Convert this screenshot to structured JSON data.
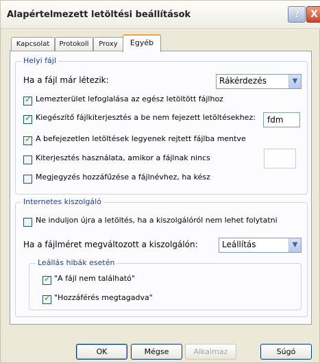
{
  "window": {
    "title": "Alapértelmezett letöltési beállítások",
    "help_label": "?",
    "close_label": "X"
  },
  "tabs": [
    {
      "label": "Kapcsolat"
    },
    {
      "label": "Protokoll"
    },
    {
      "label": "Proxy"
    },
    {
      "label": "Egyéb",
      "active": true
    }
  ],
  "local_file": {
    "legend": "Helyi fájl",
    "if_exists_label": "Ha a fájl már létezik:",
    "if_exists_value": "Rákérdezés",
    "options": [
      {
        "label": "Lemezterület lefoglalása az egész letöltött fájlhoz",
        "checked": true
      },
      {
        "label": "Kiegészítő fájlkiterjesztés a be nem fejezett letöltésekhez:",
        "checked": true,
        "value": "fdm"
      },
      {
        "label": "A befejezetlen letöltések legyenek rejtett fájlba mentve",
        "checked": true
      },
      {
        "label": "Kiterjesztés használata, amikor a fájlnak nincs",
        "checked": false,
        "value": ""
      },
      {
        "label": "Megjegyzés hozzáfűzése a fájlnévhez, ha kész",
        "checked": false
      }
    ]
  },
  "internet_server": {
    "legend": "Internetes kiszolgáló",
    "no_restart_label": "Ne induljon újra a letöltés, ha a kiszolgálóról nem lehet folytatni",
    "no_restart_checked": false,
    "size_changed_label": "Ha a fájlméret megváltozott a kiszolgálón:",
    "size_changed_value": "Leállítás",
    "stop_errors": {
      "legend": "Leállás hibák esetén",
      "items": [
        {
          "label": "\"A fájl nem található\"",
          "checked": true
        },
        {
          "label": "\"Hozzáférés megtagadva\"",
          "checked": true
        }
      ]
    }
  },
  "buttons": {
    "ok": "OK",
    "cancel": "Mégse",
    "apply": "Alkalmaz",
    "help": "Súgó"
  },
  "colors": {
    "group_label": "#1f3e8a",
    "check": "#21a121",
    "active_tab_accent": "#f0a43a"
  }
}
